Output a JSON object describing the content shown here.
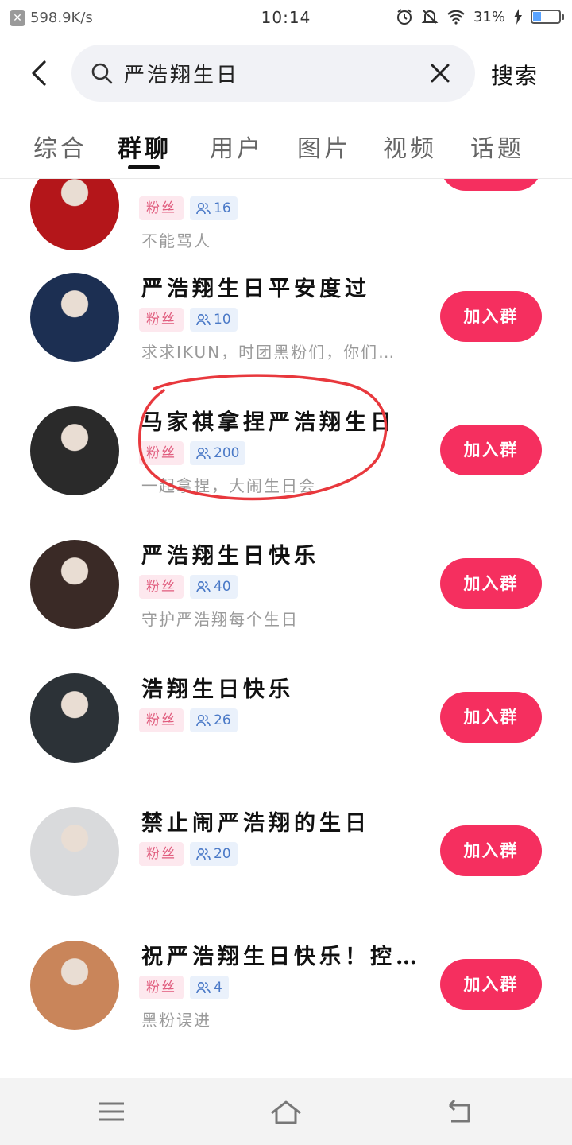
{
  "status_bar": {
    "speed": "598.9K/s",
    "time": "10:14",
    "battery": "31%",
    "battery_level": 0.31
  },
  "search": {
    "query": "严浩翔生日",
    "search_button": "搜索"
  },
  "tabs": [
    {
      "label": "综合",
      "active": false
    },
    {
      "label": "群聊",
      "active": true
    },
    {
      "label": "用户",
      "active": false
    },
    {
      "label": "图片",
      "active": false
    },
    {
      "label": "视频",
      "active": false
    },
    {
      "label": "话题",
      "active": false
    }
  ],
  "groups": [
    {
      "title": "",
      "tag": "粉丝",
      "members": "16",
      "desc": "不能骂人",
      "join": "加入群",
      "avatar_color": "#b4161a"
    },
    {
      "title": "严浩翔生日平安度过",
      "tag": "粉丝",
      "members": "10",
      "desc": "求求IKUN，时团黑粉们，你们…",
      "join": "加入群",
      "avatar_color": "#1c2f52"
    },
    {
      "title": "马家祺拿捏严浩翔生日",
      "tag": "粉丝",
      "members": "200",
      "desc": "一起拿捏，大闹生日会",
      "join": "加入群",
      "avatar_color": "#2a2a2a"
    },
    {
      "title": "严浩翔生日快乐",
      "tag": "粉丝",
      "members": "40",
      "desc": "守护严浩翔每个生日",
      "join": "加入群",
      "avatar_color": "#3a2a26"
    },
    {
      "title": "浩翔生日快乐",
      "tag": "粉丝",
      "members": "26",
      "desc": "",
      "join": "加入群",
      "avatar_color": "#2c3237"
    },
    {
      "title": "禁止闹严浩翔的生日",
      "tag": "粉丝",
      "members": "20",
      "desc": "",
      "join": "加入群",
      "avatar_color": "#d9dadc"
    },
    {
      "title": "祝严浩翔生日快乐！控…",
      "tag": "粉丝",
      "members": "4",
      "desc": "黑粉误进",
      "join": "加入群",
      "avatar_color": "#c9855a"
    }
  ],
  "colors": {
    "accent": "#f52f5f",
    "annotation": "#e8383d"
  }
}
